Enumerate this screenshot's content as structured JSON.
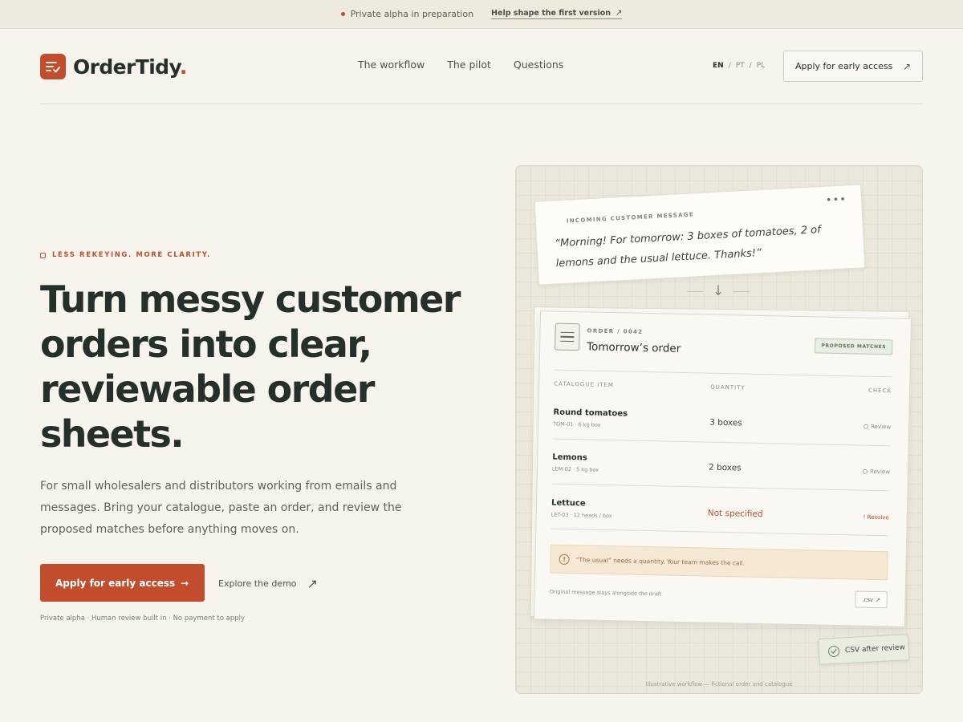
{
  "announcement": {
    "status": "Private alpha in preparation",
    "link_label": "Help shape the first version",
    "link_arrow": "↗"
  },
  "header": {
    "brand": "OrderTidy",
    "brand_period": ".",
    "nav": [
      "The workflow",
      "The pilot",
      "Questions"
    ],
    "languages": [
      "EN",
      "PT",
      "PL"
    ],
    "active_language": "EN",
    "cta_label": "Apply for early access",
    "cta_arrow": "↗"
  },
  "hero": {
    "eyebrow": "LESS REKEYING. MORE CLARITY.",
    "title_lines": [
      "Turn messy customer",
      "orders into clear,",
      "reviewable order",
      "sheets."
    ],
    "subtitle": "For small wholesalers and distributors working from emails and messages. Bring your catalogue, paste an order, and review the proposed matches before anything moves on.",
    "primary_cta": "Apply for early access",
    "primary_arrow": "→",
    "secondary_cta": "Explore the demo",
    "secondary_arrow": "↗",
    "fineprint": "Private alpha · Human review built in · No payment to apply"
  },
  "illustration": {
    "message": {
      "label": "INCOMING CUSTOMER MESSAGE",
      "menu": "•••",
      "text": "“Morning! For tomorrow: 3 boxes of tomatoes, 2 of lemons and the usual lettuce. Thanks!”"
    },
    "flow_arrow": "↓",
    "order": {
      "number": "ORDER / 0042",
      "title": "Tomorrow’s order",
      "badge": "PROPOSED MATCHES",
      "columns": [
        "CATALOGUE ITEM",
        "QUANTITY",
        "CHECK"
      ],
      "rows": [
        {
          "name": "Round tomatoes",
          "sku": "TOM-01 · 6 kg box",
          "qty": "3 boxes",
          "check": "Review"
        },
        {
          "name": "Lemons",
          "sku": "LEM-02 · 5 kg box",
          "qty": "2 boxes",
          "check": "Review"
        },
        {
          "name": "Lettuce",
          "sku": "LET-03 · 12 heads / box",
          "qty": "Not specified",
          "check": "! Resolve"
        }
      ],
      "alert": "“The usual” needs a quantity. Your team makes the call.",
      "alert_icon": "!",
      "footnote": "Original message stays alongside the draft",
      "export_label": ".csv",
      "export_arrow": "↗"
    },
    "csv_badge": "CSV after review",
    "caption": "Illustrative workflow — fictional order and catalogue"
  },
  "colors": {
    "accent": "#c14d2d",
    "background": "#f7f4ed",
    "ink": "#26302a",
    "success": "#5d7159"
  }
}
